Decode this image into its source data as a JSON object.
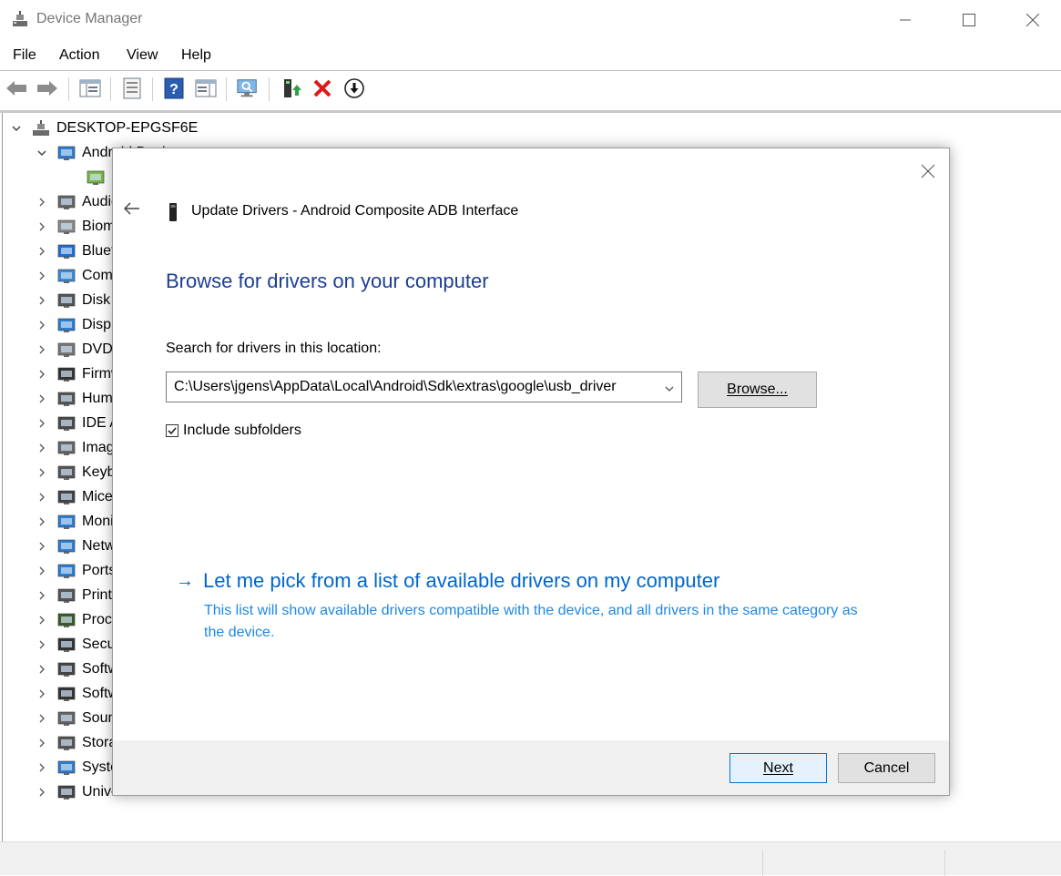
{
  "window": {
    "title": "Device Manager",
    "menu": [
      "File",
      "Action",
      "View",
      "Help"
    ]
  },
  "toolbar": {
    "buttons": [
      "back-icon",
      "forward-icon",
      "show-hide-tree-icon",
      "properties-icon",
      "help-icon",
      "run-action-icon",
      "scan-hardware-icon",
      "update-driver-icon",
      "uninstall-icon",
      "disable-device-icon"
    ]
  },
  "tree": {
    "root": "DESKTOP-EPGSF6E",
    "items": [
      {
        "label": "Android Device",
        "expanded": true
      },
      {
        "label": "",
        "child": true
      },
      {
        "label": "Audio inputs and outputs"
      },
      {
        "label": "Biometric devices"
      },
      {
        "label": "Bluetooth"
      },
      {
        "label": "Computer"
      },
      {
        "label": "Disk drives"
      },
      {
        "label": "Display adapters"
      },
      {
        "label": "DVD/CD-ROM drives"
      },
      {
        "label": "Firmware"
      },
      {
        "label": "Human Interface Devices"
      },
      {
        "label": "IDE ATA/ATAPI controllers"
      },
      {
        "label": "Imaging devices"
      },
      {
        "label": "Keyboards"
      },
      {
        "label": "Mice and other pointing devices"
      },
      {
        "label": "Monitors"
      },
      {
        "label": "Network adapters"
      },
      {
        "label": "Ports (COM & LPT)"
      },
      {
        "label": "Print queues"
      },
      {
        "label": "Processors"
      },
      {
        "label": "Security devices"
      },
      {
        "label": "Software components"
      },
      {
        "label": "Software devices"
      },
      {
        "label": "Sound, video and game controllers"
      },
      {
        "label": "Storage controllers"
      },
      {
        "label": "System devices"
      },
      {
        "label": "Universal Serial Bus controllers"
      }
    ]
  },
  "dialog": {
    "title": "Update Drivers - Android Composite ADB Interface",
    "heading": "Browse for drivers on your computer",
    "search_label": "Search for drivers in this location:",
    "path_value": "C:\\Users\\jgens\\AppData\\Local\\Android\\Sdk\\extras\\google\\usb_driver",
    "browse_label": "Browse...",
    "include_subfolders_label": "Include subfolders",
    "include_subfolders_checked": true,
    "pick_title": "Let me pick from a list of available drivers on my computer",
    "pick_desc": "This list will show available drivers compatible with the device, and all drivers in the same category as the device.",
    "next_label": "Next",
    "cancel_label": "Cancel"
  },
  "colors": {
    "heading": "#1c3f94",
    "link": "#0066cc",
    "link_desc": "#1e88e5",
    "default_button_border": "#0078d7"
  }
}
